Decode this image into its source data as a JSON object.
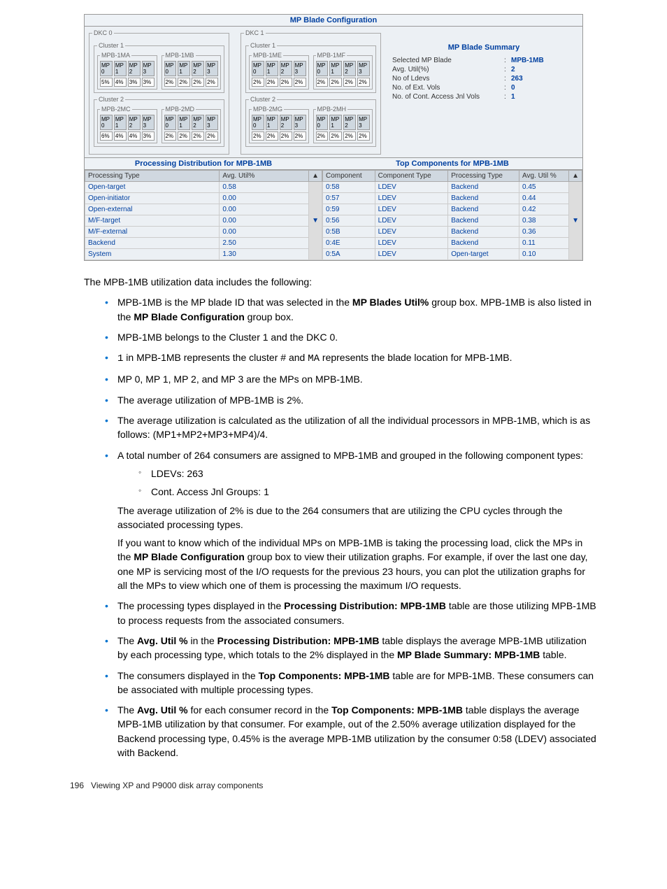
{
  "screenshot": {
    "title": "MP Blade Configuration",
    "dkc": [
      {
        "name": "DKC 0",
        "clusters": [
          {
            "name": "Cluster 1",
            "blades": [
              {
                "name": "MPB-1MA",
                "mp": [
                  "MP 0",
                  "MP 1",
                  "MP 2",
                  "MP 3"
                ],
                "pct": [
                  "5%",
                  "4%",
                  "3%",
                  "3%"
                ]
              },
              {
                "name": "MPB-1MB",
                "mp": [
                  "MP 0",
                  "MP 1",
                  "MP 2",
                  "MP 3"
                ],
                "pct": [
                  "2%",
                  "2%",
                  "2%",
                  "2%"
                ]
              }
            ]
          },
          {
            "name": "Cluster 2",
            "blades": [
              {
                "name": "MPB-2MC",
                "mp": [
                  "MP 0",
                  "MP 1",
                  "MP 2",
                  "MP 3"
                ],
                "pct": [
                  "6%",
                  "4%",
                  "4%",
                  "3%"
                ]
              },
              {
                "name": "MPB-2MD",
                "mp": [
                  "MP 0",
                  "MP 1",
                  "MP 2",
                  "MP 3"
                ],
                "pct": [
                  "2%",
                  "2%",
                  "2%",
                  "2%"
                ]
              }
            ]
          }
        ]
      },
      {
        "name": "DKC 1",
        "clusters": [
          {
            "name": "Cluster 1",
            "blades": [
              {
                "name": "MPB-1ME",
                "mp": [
                  "MP 0",
                  "MP 1",
                  "MP 2",
                  "MP 3"
                ],
                "pct": [
                  "2%",
                  "2%",
                  "2%",
                  "2%"
                ]
              },
              {
                "name": "MPB-1MF",
                "mp": [
                  "MP 0",
                  "MP 1",
                  "MP 2",
                  "MP 3"
                ],
                "pct": [
                  "2%",
                  "2%",
                  "2%",
                  "2%"
                ]
              }
            ]
          },
          {
            "name": "Cluster 2",
            "blades": [
              {
                "name": "MPB-2MG",
                "mp": [
                  "MP 0",
                  "MP 1",
                  "MP 2",
                  "MP 3"
                ],
                "pct": [
                  "2%",
                  "2%",
                  "2%",
                  "2%"
                ]
              },
              {
                "name": "MPB-2MH",
                "mp": [
                  "MP 0",
                  "MP 1",
                  "MP 2",
                  "MP 3"
                ],
                "pct": [
                  "2%",
                  "2%",
                  "2%",
                  "2%"
                ]
              }
            ]
          }
        ]
      }
    ],
    "summary": {
      "title": "MP Blade Summary",
      "rows": [
        {
          "label": "Selected MP Blade",
          "value": "MPB-1MB"
        },
        {
          "label": "Avg. Util(%)",
          "value": "2"
        },
        {
          "label": "No of Ldevs",
          "value": "263"
        },
        {
          "label": "No. of Ext. Vols",
          "value": "0"
        },
        {
          "label": "No. of Cont. Access Jnl Vols",
          "value": "1"
        }
      ]
    },
    "proc_dist": {
      "title": "Processing Distribution for MPB-1MB",
      "headers": [
        "Processing Type",
        "Avg. Util%"
      ],
      "rows": [
        [
          "Open-target",
          "0.58"
        ],
        [
          "Open-initiator",
          "0.00"
        ],
        [
          "Open-external",
          "0.00"
        ],
        [
          "M/F-target",
          "0.00"
        ],
        [
          "M/F-external",
          "0.00"
        ],
        [
          "Backend",
          "2.50"
        ],
        [
          "System",
          "1.30"
        ]
      ]
    },
    "top_comp": {
      "title": "Top Components for MPB-1MB",
      "headers": [
        "Component",
        "Component Type",
        "Processing Type",
        "Avg. Util %"
      ],
      "rows": [
        [
          "0:58",
          "LDEV",
          "Backend",
          "0.45"
        ],
        [
          "0:57",
          "LDEV",
          "Backend",
          "0.44"
        ],
        [
          "0:59",
          "LDEV",
          "Backend",
          "0.42"
        ],
        [
          "0:56",
          "LDEV",
          "Backend",
          "0.38"
        ],
        [
          "0:5B",
          "LDEV",
          "Backend",
          "0.36"
        ],
        [
          "0:4E",
          "LDEV",
          "Backend",
          "0.11"
        ],
        [
          "0:5A",
          "LDEV",
          "Open-target",
          "0.10"
        ]
      ]
    }
  },
  "doc": {
    "intro": "The MPB-1MB utilization data includes the following:",
    "bullets": {
      "b1a": "MPB-1MB is the MP blade ID that was selected in the ",
      "b1b": "MP Blades Util%",
      "b1c": " group box. MPB-1MB is also listed in the ",
      "b1d": "MP Blade Configuration",
      "b1e": " group box.",
      "b2": "MPB-1MB belongs to the Cluster 1 and the DKC 0.",
      "b3a": "1",
      "b3b": " in MPB-1MB represents the cluster # and ",
      "b3c": "MA",
      "b3d": " represents the blade location for MPB-1MB.",
      "b4": "MP 0, MP 1, MP 2, and MP 3 are the MPs on MPB-1MB.",
      "b5": "The average utilization of MPB-1MB is 2%.",
      "b6": "The average utilization is calculated as the utilization of all the individual processors in MPB-1MB, which is as follows: (MP1+MP2+MP3+MP4)/4.",
      "b7": "A total number of 264 consumers are assigned to MPB-1MB and grouped in the following component types:",
      "b7s1": "LDEVs: 263",
      "b7s2": "Cont. Access Jnl Groups: 1",
      "b7p1": "The average utilization of 2% is due to the 264 consumers that are utilizing the CPU cycles through the associated processing types.",
      "b7p2a": "If you want to know which of the individual MPs on MPB-1MB is taking the processing load, click the MPs in the ",
      "b7p2b": "MP Blade Configuration",
      "b7p2c": " group box to view their utilization graphs. For example, if over the last one day, one MP is servicing most of the I/O requests for the previous 23 hours, you can plot the utilization graphs for all the MPs to view which one of them is processing the maximum I/O requests.",
      "b8a": "The processing types displayed in the ",
      "b8b": "Processing Distribution: MPB-1MB",
      "b8c": " table are those utilizing MPB-1MB to process requests from the associated consumers.",
      "b9a": "The ",
      "b9b": "Avg. Util %",
      "b9c": " in the ",
      "b9d": "Processing Distribution: MPB-1MB",
      "b9e": " table displays the average MPB-1MB utilization by each processing type, which totals to the 2% displayed in the ",
      "b9f": "MP Blade Summary: MPB-1MB",
      "b9g": " table.",
      "b10a": "The consumers displayed in the ",
      "b10b": "Top Components: MPB-1MB",
      "b10c": " table are for MPB-1MB. These consumers can be associated with multiple processing types.",
      "b11a": "The ",
      "b11b": "Avg. Util %",
      "b11c": " for each consumer record in the ",
      "b11d": "Top Components: MPB-1MB",
      "b11e": " table displays the average MPB-1MB utilization by that consumer. For example, out of the 2.50% average utilization displayed for the Backend processing type, 0.45% is the average MPB-1MB utilization by the consumer 0:58 (LDEV) associated with Backend."
    },
    "footer_page": "196",
    "footer_text": "Viewing XP and P9000 disk array components"
  }
}
